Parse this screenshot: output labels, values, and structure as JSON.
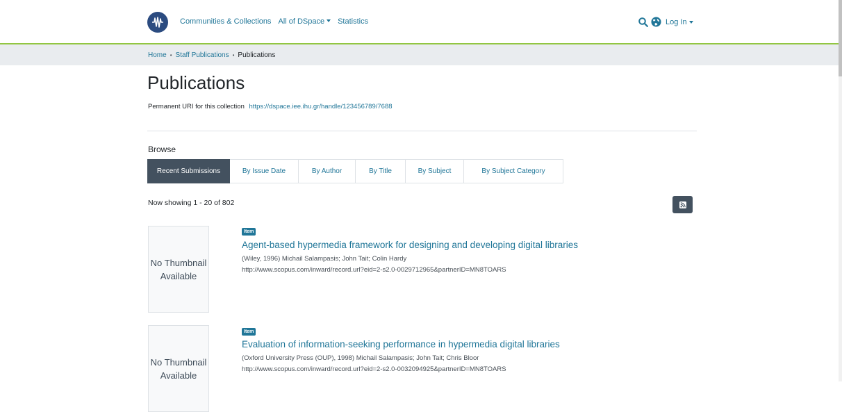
{
  "header": {
    "nav": [
      "Communities & Collections",
      "All of DSpace",
      "Statistics"
    ],
    "login": "Log In",
    "accent": "#207698"
  },
  "breadcrumb": {
    "home": "Home",
    "parent": "Staff Publications",
    "current": "Publications"
  },
  "page": {
    "title": "Publications",
    "uri_label": "Permanent URI for this collection",
    "uri": "https://dspace.iee.ihu.gr/handle/123456789/7688"
  },
  "browse": {
    "label": "Browse",
    "tabs": [
      "Recent Submissions",
      "By Issue Date",
      "By Author",
      "By Title",
      "By Subject",
      "By Subject Category"
    ],
    "active_tab": "Recent Submissions"
  },
  "results": {
    "showing": "Now showing 1 - 20 of 802"
  },
  "items": [
    {
      "badge": "Item",
      "thumbnail": "No Thumbnail Available",
      "title": "Agent-based hypermedia framework for designing and developing digital libraries",
      "meta": "(Wiley, 1996) Michail Salampasis; John Tait; Colin Hardy",
      "url": "http://www.scopus.com/inward/record.url?eid=2-s2.0-0029712965&partnerID=MN8TOARS"
    },
    {
      "badge": "Item",
      "thumbnail": "No Thumbnail Available",
      "title": "Evaluation of information-seeking performance in hypermedia digital libraries",
      "meta": "(Oxford University Press (OUP), 1998) Michail Salampasis; John Tait; Chris Bloor",
      "url": "http://www.scopus.com/inward/record.url?eid=2-s2.0-0032094925&partnerID=MN8TOARS"
    }
  ]
}
